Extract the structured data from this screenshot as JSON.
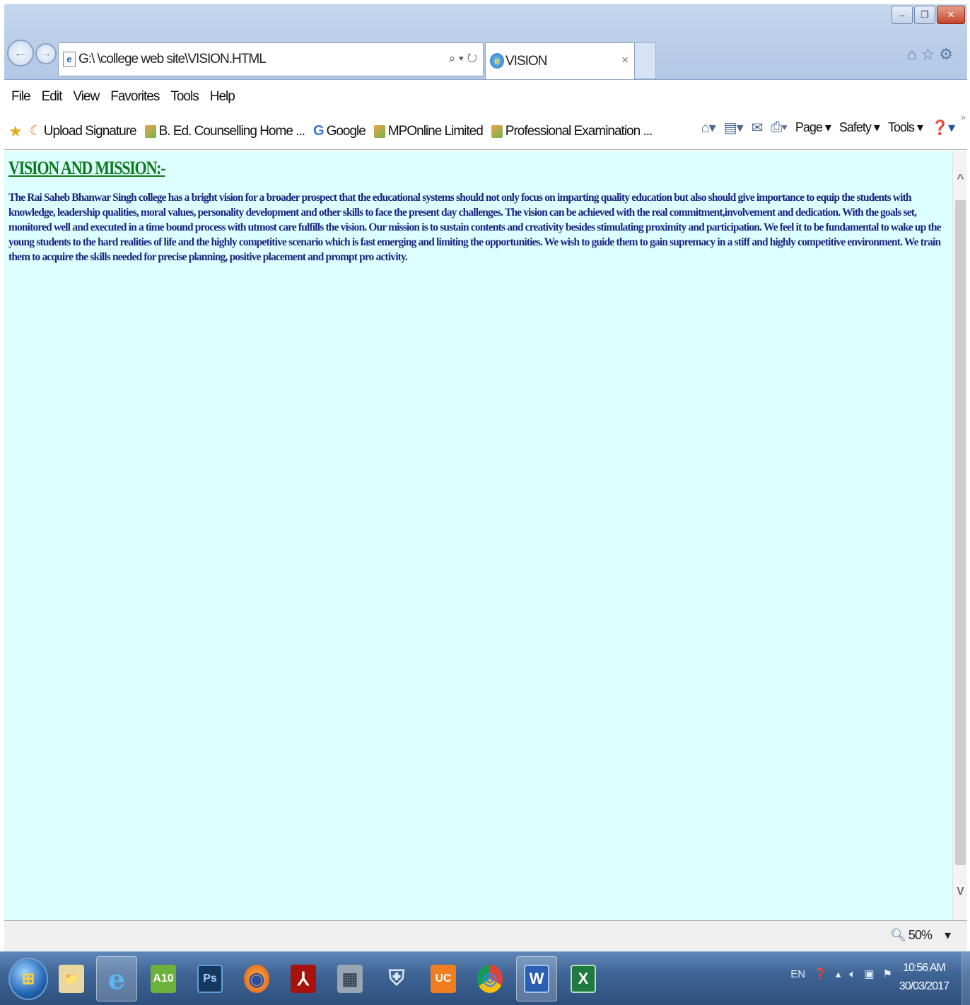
{
  "window": {
    "minimize_glyph": "–",
    "maximize_glyph": "❐",
    "close_glyph": "✕"
  },
  "browser": {
    "address": "G:\\ \\college web site\\VISION.HTML",
    "address_tools": "⌕ ▾ ↻",
    "tab_title": "VISION",
    "tab_close": "×",
    "back_glyph": "←",
    "forward_glyph": "→",
    "right_tools": "⌂☆⚙"
  },
  "menu": [
    "File",
    "Edit",
    "View",
    "Favorites",
    "Tools",
    "Help"
  ],
  "favorites": [
    {
      "label": "Upload Signature",
      "icon": "loading-icon"
    },
    {
      "label": "B. Ed. Counselling Home ...",
      "icon": "site-icon"
    },
    {
      "label": "Google",
      "icon": "google-icon"
    },
    {
      "label": "MPOnline Limited",
      "icon": "site-icon"
    },
    {
      "label": "Professional Examination ...",
      "icon": "site-icon"
    }
  ],
  "commandbar": {
    "page": "Page ▾",
    "safety": "Safety ▾",
    "tools": "Tools ▾"
  },
  "page": {
    "heading": "VISION AND MISSION:-",
    "body": "The Rai Saheb Bhanwar Singh college has a bright vision for a broader prospect that the educational systems should not only focus on imparting quality education but also should give importance to equip the students with knowledge, leadership qualities, moral values, personality development and other skills to face the present day challenges. The vision can be achieved with the real commitment,involvement and dedication. With the goals set, monitored well and executed in a time bound process with utmost care fulfills the vision. Our mission is to sustain contents and creativity besides stimulating proximity and participation. We feel it to be fundamental to wake up the young students to the hard realities of life and the highly competitive scenario which is fast emerging and limiting the opportunities. We wish to guide them to gain supremacy in a stiff and highly competitive environment. We train them to acquire the skills needed for precise planning, positive placement and prompt pro activity."
  },
  "status": {
    "zoom": "50%"
  },
  "taskbar": {
    "apps": [
      {
        "name": "explorer",
        "glyph": "📁"
      },
      {
        "name": "internet-explorer",
        "glyph": "e"
      },
      {
        "name": "a10",
        "glyph": "A10"
      },
      {
        "name": "photoshop",
        "glyph": "Ps"
      },
      {
        "name": "firefox",
        "glyph": "◉"
      },
      {
        "name": "acrobat",
        "glyph": "⅄"
      },
      {
        "name": "file-manager",
        "glyph": "▦"
      },
      {
        "name": "security",
        "glyph": "⛨"
      },
      {
        "name": "uc-browser",
        "glyph": "UC"
      },
      {
        "name": "chrome",
        "glyph": "◎"
      },
      {
        "name": "word",
        "glyph": "W"
      },
      {
        "name": "excel",
        "glyph": "X"
      }
    ],
    "lang": "EN",
    "time": "10:56 AM",
    "date": "30/03/2017"
  },
  "colors": {
    "page_bg": "#ddffff",
    "heading": "#0c7a1a",
    "body_text": "#1c2580"
  }
}
